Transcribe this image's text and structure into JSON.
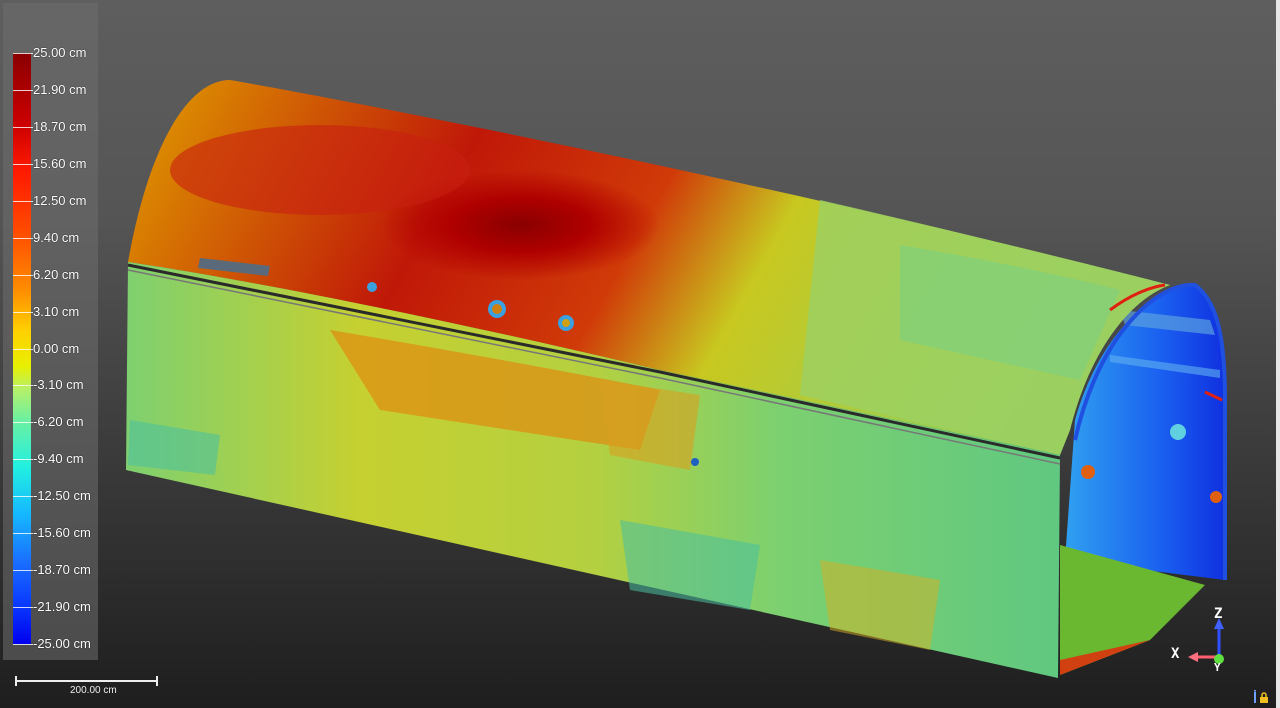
{
  "color_scale": {
    "labels": [
      "25.00 cm",
      "21.90 cm",
      "18.70 cm",
      "15.60 cm",
      "12.50 cm",
      "9.40 cm",
      "6.20 cm",
      "3.10 cm",
      "0.00 cm",
      "-3.10 cm",
      "-6.20 cm",
      "-9.40 cm",
      "-12.50 cm",
      "-15.60 cm",
      "-18.70 cm",
      "-21.90 cm",
      "-25.00 cm"
    ]
  },
  "scale_bar": {
    "label": "200.00 cm"
  },
  "axes": {
    "z": "Z",
    "x": "X",
    "y": "Y"
  },
  "colors": {
    "max": "#8a0000",
    "mid": "#e8f000",
    "min": "#0000ee",
    "background_top": "#5e5e5e",
    "background_bottom": "#1e1e1e"
  },
  "icons": {
    "lock": "lock-icon",
    "info": "info-icon"
  }
}
